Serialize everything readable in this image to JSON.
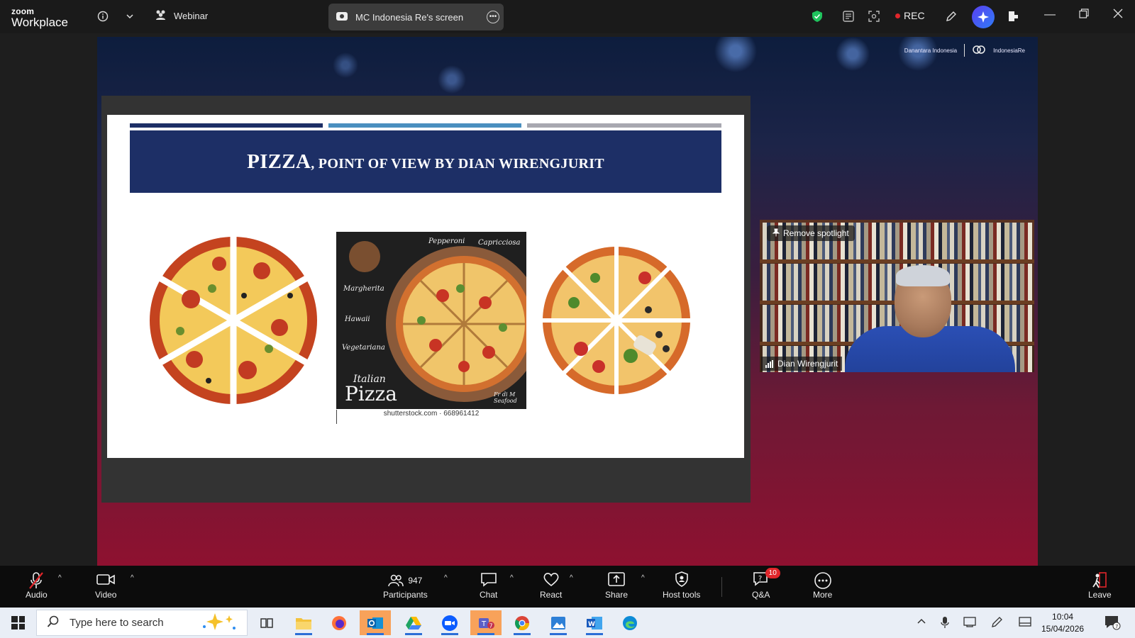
{
  "titlebar": {
    "logo_small": "zoom",
    "logo_large": "Workplace",
    "webinar_label": "Webinar",
    "share_tab_label": "MC Indonesia Re's screen",
    "rec_label": "REC",
    "icons": [
      "info-icon",
      "chevron-down-icon",
      "webinar-icon",
      "shield-check-icon",
      "notes-icon",
      "apps-icon",
      "annotate-icon",
      "ai-companion-icon",
      "share-screen-icon",
      "minimize-icon",
      "restore-icon",
      "close-icon"
    ]
  },
  "slide": {
    "title_first": "PIZZA",
    "title_rest": ", POINT OF VIEW BY DIAN WIRENGJURIT",
    "bar_colors": [
      "#1d2f66",
      "#4a8fbf",
      "#a8a8b0"
    ],
    "menu_top_left": "Pepperoni",
    "menu_top_right": "Capricciosa",
    "menu_items": [
      "Margherita",
      "Hawaii",
      "Vegetariana"
    ],
    "script_small": "Italian",
    "script_big": "Pizza",
    "side_text": "Fr di M Seafood",
    "credit": "shutterstock.com · 668961412"
  },
  "brand": {
    "left": "Danantara Indonesia",
    "right": "IndonesiaRe"
  },
  "video": {
    "spotlight_label": "Remove spotlight",
    "participant_name": "Dian Wirengjurit"
  },
  "toolbar": {
    "audio": "Audio",
    "video": "Video",
    "participants": "Participants",
    "participants_count": "947",
    "chat": "Chat",
    "react": "React",
    "share": "Share",
    "host_tools": "Host tools",
    "qa": "Q&A",
    "qa_badge": "10",
    "more": "More",
    "leave": "Leave"
  },
  "taskbar": {
    "search_placeholder": "Type here to search",
    "time": "10:04",
    "date": "15/04/2026",
    "notification_count": "7",
    "teams_badge": "7"
  },
  "colors": {
    "accent": "#2b6ed6",
    "rec_red": "#e0262b",
    "slide_title_bg": "#1d2f66"
  }
}
